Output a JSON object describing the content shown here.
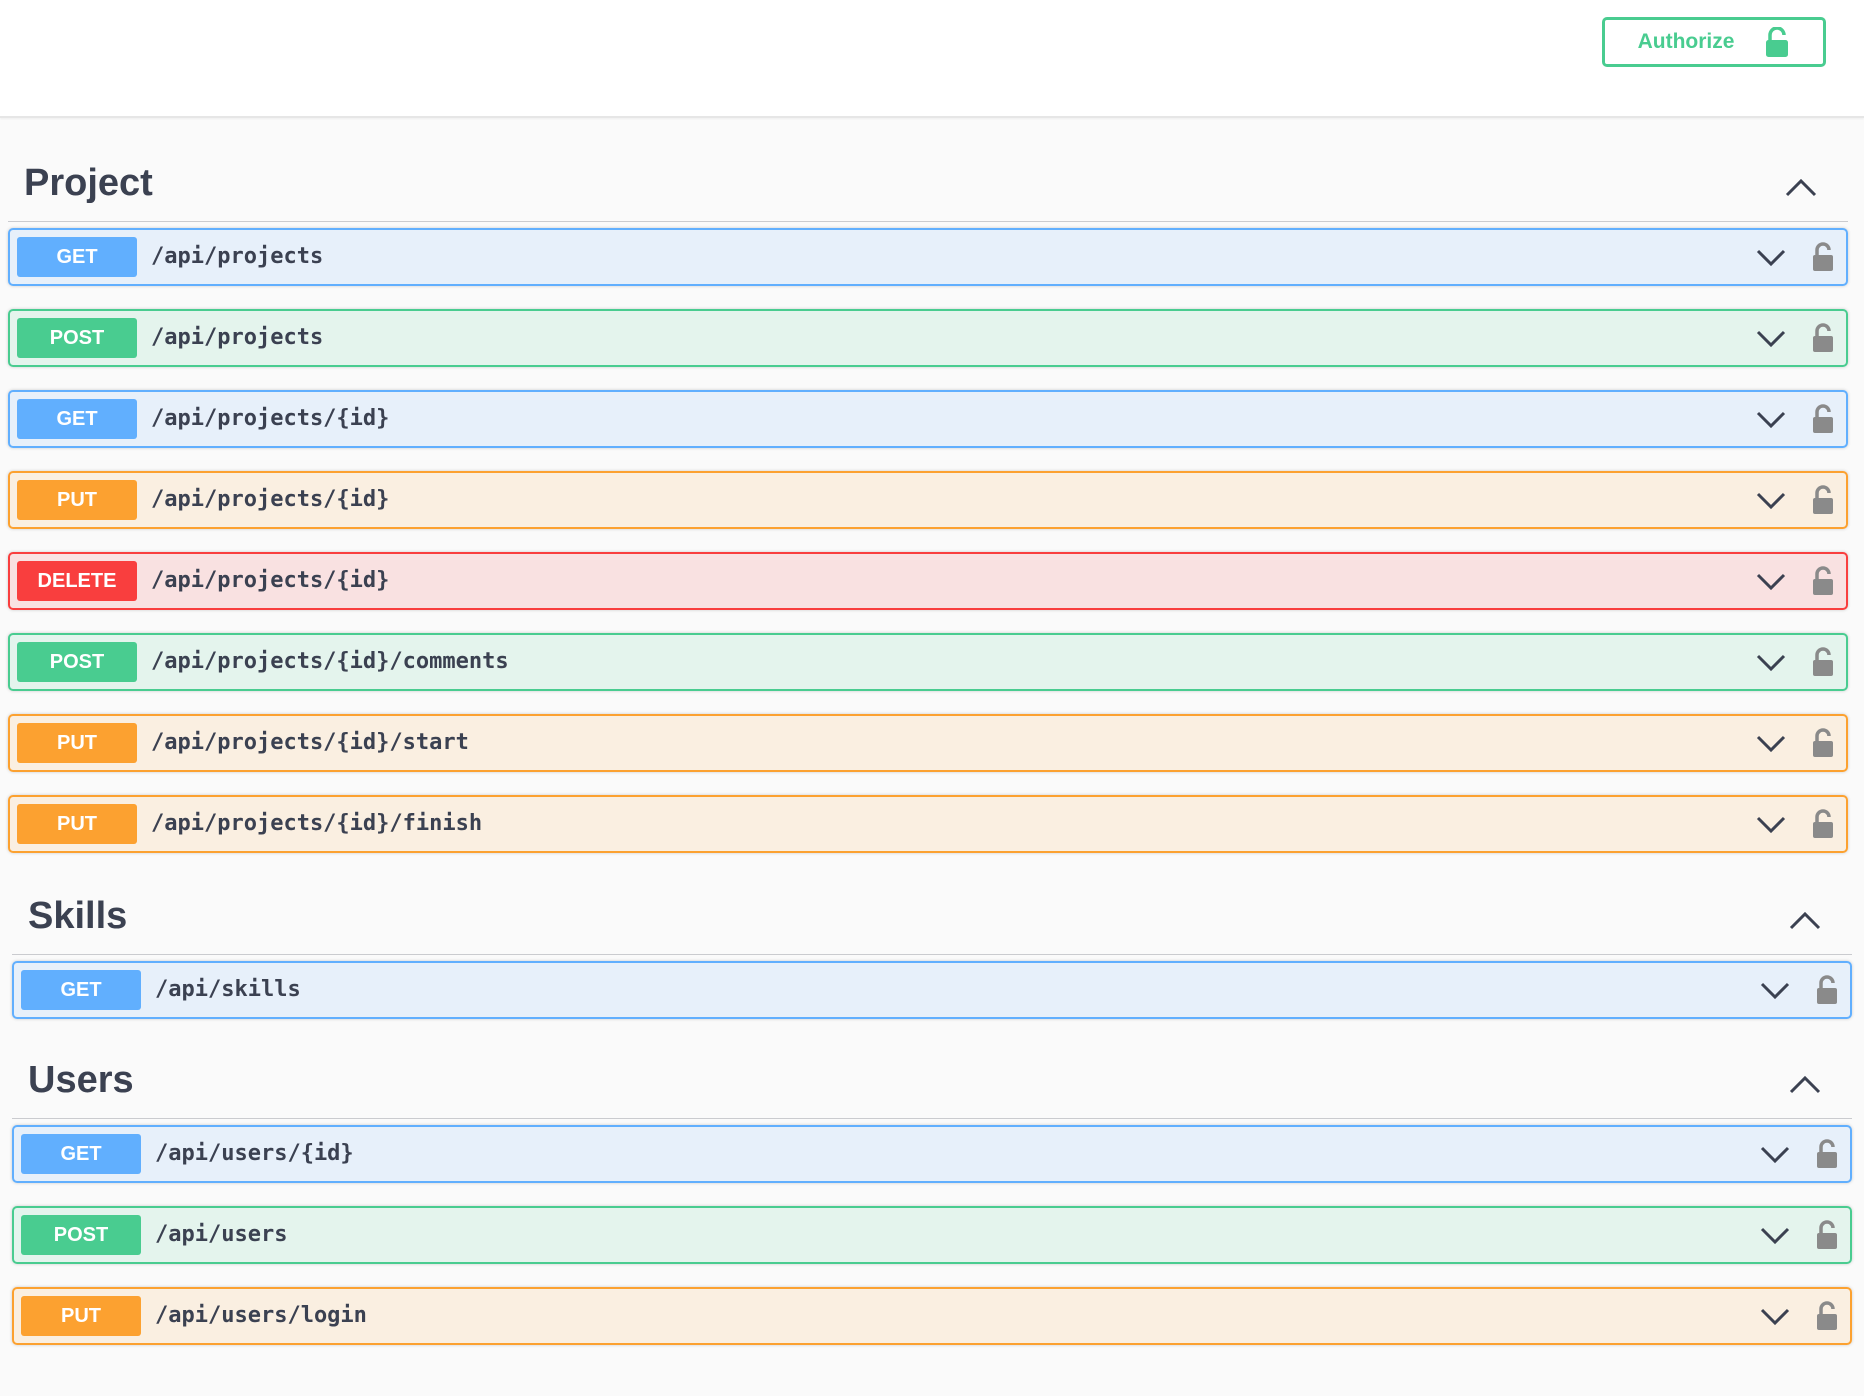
{
  "topbar": {
    "authorize_label": "Authorize",
    "authorize_icon": "unlocked-lock-icon",
    "accent_color": "#49cc90"
  },
  "colors": {
    "GET": "#61afe1",
    "POST": "#49cc90",
    "PUT": "#fca130",
    "DELETE": "#f93e3e"
  },
  "sections": [
    {
      "title": "Project",
      "toggle_icon": "chevron-up-icon",
      "operations": [
        {
          "method": "GET",
          "path": "/api/projects"
        },
        {
          "method": "POST",
          "path": "/api/projects"
        },
        {
          "method": "GET",
          "path": "/api/projects/{id}"
        },
        {
          "method": "PUT",
          "path": "/api/projects/{id}"
        },
        {
          "method": "DELETE",
          "path": "/api/projects/{id}"
        },
        {
          "method": "POST",
          "path": "/api/projects/{id}/comments"
        },
        {
          "method": "PUT",
          "path": "/api/projects/{id}/start"
        },
        {
          "method": "PUT",
          "path": "/api/projects/{id}/finish"
        }
      ]
    },
    {
      "title": "Skills",
      "toggle_icon": "chevron-up-icon",
      "operations": [
        {
          "method": "GET",
          "path": "/api/skills"
        }
      ]
    },
    {
      "title": "Users",
      "toggle_icon": "chevron-up-icon",
      "operations": [
        {
          "method": "GET",
          "path": "/api/users/{id}"
        },
        {
          "method": "POST",
          "path": "/api/users"
        },
        {
          "method": "PUT",
          "path": "/api/users/login"
        }
      ]
    }
  ]
}
